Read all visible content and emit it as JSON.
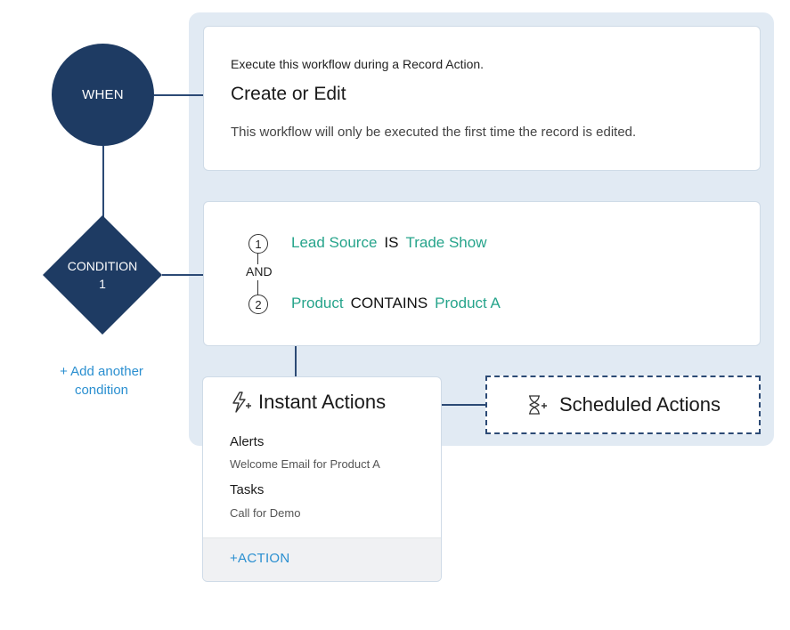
{
  "trigger": {
    "node_label": "WHEN",
    "intro": "Execute this workflow during a Record Action.",
    "title": "Create or Edit",
    "description": "This workflow will only be executed the first time the record is edited."
  },
  "condition": {
    "node_label_line1": "CONDITION",
    "node_label_line2": "1",
    "add_link": "+ Add another condition",
    "connector": "AND",
    "criteria": [
      {
        "num": "1",
        "field": "Lead Source",
        "operator": "IS",
        "value": "Trade Show"
      },
      {
        "num": "2",
        "field": "Product",
        "operator": "CONTAINS",
        "value": "Product A"
      }
    ]
  },
  "instant_actions": {
    "icon": "lightning-plus-icon",
    "title": "Instant Actions",
    "sections": [
      {
        "label": "Alerts",
        "item": "Welcome Email for Product A"
      },
      {
        "label": "Tasks",
        "item": "Call for Demo"
      }
    ],
    "add_action": "+ACTION"
  },
  "scheduled_actions": {
    "icon": "hourglass-plus-icon",
    "title": "Scheduled Actions"
  },
  "colors": {
    "node": "#1e3b63",
    "accent_green": "#26a48b",
    "link_blue": "#2a8fd0",
    "panel_bg": "#e1eaf3"
  }
}
